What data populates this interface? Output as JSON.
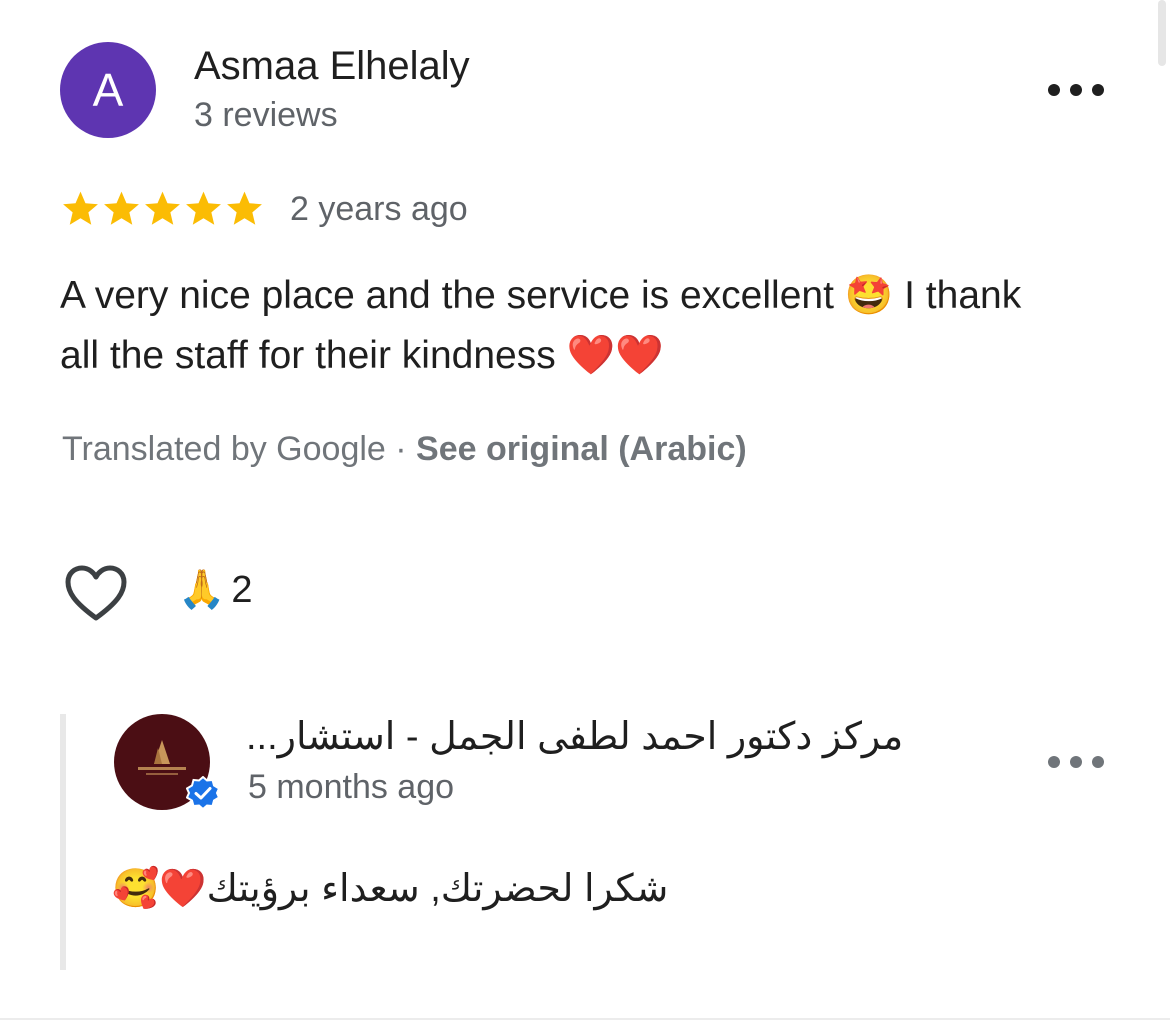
{
  "review": {
    "avatar_letter": "A",
    "avatar_color": "#5e35b1",
    "reviewer_name": "Asmaa Elhelaly",
    "reviewer_meta": "3 reviews",
    "rating": 5,
    "max_rating": 5,
    "star_color": "#fbbc04",
    "time": "2 years ago",
    "text": "A very nice place and the service is excellent 🤩 I thank all the staff for their kindness ❤️❤️",
    "translated_by": "Translated by Google",
    "separator": " · ",
    "see_original": "See original (Arabic)",
    "more_options_icon": "more-horizontal-icon"
  },
  "reactions": {
    "like_icon": "heart-outline-icon",
    "emoji": "🙏",
    "count": "2"
  },
  "owner_reply": {
    "name": "مركز دكتور احمد لطفى الجمل - استشار...",
    "time": "5 months ago",
    "text": "شكرا لحضرتك, سعداء برؤيتك❤️🥰",
    "badge_icon": "verified-check-icon",
    "avatar_logo_icon": "clinic-logo-icon",
    "badge_color": "#1a73e8",
    "more_options_icon": "more-horizontal-icon"
  }
}
